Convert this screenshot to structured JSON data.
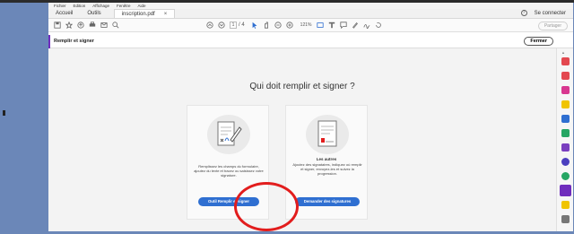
{
  "menu": [
    "Fichier",
    "Edition",
    "Affichage",
    "Fenêtre",
    "Aide"
  ],
  "tabs": {
    "home": "Accueil",
    "tools": "Outils",
    "document": "inscription.pdf",
    "close": "×"
  },
  "account": {
    "help": "?",
    "signin": "Se connecter"
  },
  "toolbar": {
    "page_current": "1",
    "page_total": "/ 4",
    "zoom": "121%",
    "share": "Partager"
  },
  "panel": {
    "title": "Remplir et signer",
    "close": "Fermer"
  },
  "main": {
    "heading": "Qui doit remplir et signer ?",
    "cards": [
      {
        "title": "",
        "description": "Remplissez les champs du formulaire, ajoutez du texte et tracez ou saisissez votre signature.",
        "button": "Outil Remplir et signer"
      },
      {
        "title": "Les autres",
        "description": "Ajoutez des signataires, indiquez où remplir et signer, envoyez-les et suivez la progression.",
        "button": "Demander des signatures"
      }
    ]
  },
  "colors": {
    "accent": "#6f2dbd",
    "button": "#2f6fd1",
    "annotation": "#e21d1d",
    "background": "#6b87b8"
  },
  "rail_icons": [
    "create-pdf-icon",
    "export-pdf-icon",
    "edit-pdf-icon",
    "comment-icon",
    "combine-icon",
    "organize-icon",
    "fill-sign-icon",
    "protect-icon",
    "optimize-icon",
    "fill-sign-active-icon",
    "more-tools-icon",
    "signature-icon"
  ]
}
